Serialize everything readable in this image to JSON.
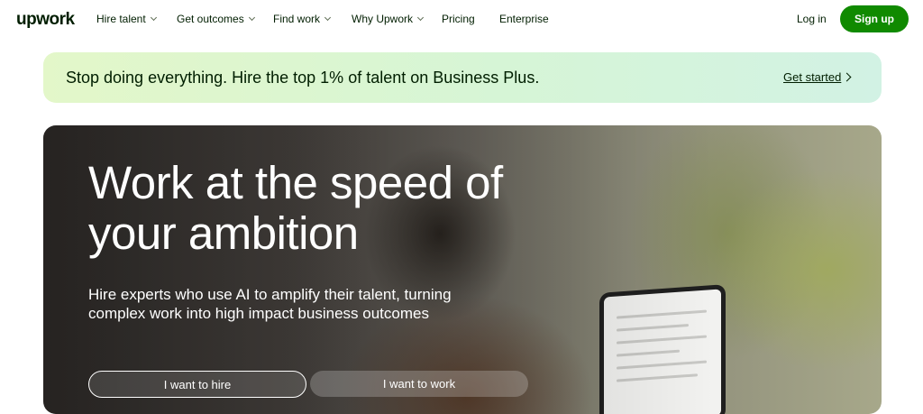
{
  "nav": {
    "logo": "upwork",
    "items": [
      {
        "label": "Hire talent",
        "has_menu": true
      },
      {
        "label": "Get outcomes",
        "has_menu": true
      },
      {
        "label": "Find work",
        "has_menu": true
      },
      {
        "label": "Why Upwork",
        "has_menu": true
      },
      {
        "label": "Pricing",
        "has_menu": false
      },
      {
        "label": "Enterprise",
        "has_menu": false
      }
    ],
    "login": "Log in",
    "signup": "Sign up"
  },
  "banner": {
    "text": "Stop doing everything. Hire the top 1% of talent on Business Plus.",
    "link": "Get started"
  },
  "hero": {
    "title_line1": "Work at the speed of",
    "title_line2": "your ambition",
    "subtitle_line1": "Hire experts who use AI to amplify their talent, turning",
    "subtitle_line2": "complex work into high impact business outcomes",
    "hire_button": "I want to hire",
    "work_button": "I want to work"
  },
  "colors": {
    "brand_green": "#108a00",
    "text_dark": "#001e00",
    "banner_start": "#e3f7c9",
    "banner_end": "#d2f2e4"
  },
  "icons": [
    "chevron-down-icon",
    "chevron-right-icon"
  ]
}
